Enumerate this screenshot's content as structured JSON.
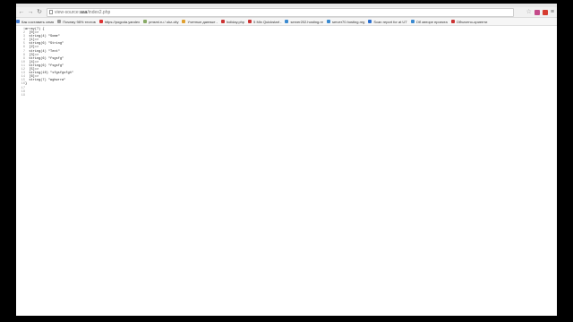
{
  "toolbar": {
    "back_icon": "back-arrow-icon",
    "forward_icon": "forward-arrow-icon",
    "reload_icon": "reload-icon",
    "url_scheme": "view-source:",
    "url_host": "aaa",
    "url_path": "/index2.php"
  },
  "bookmarks": [
    {
      "label": "Как составить семя",
      "color": "#4a7fd0"
    },
    {
      "label": "Почему 98% тестов",
      "color": "#9a9a9a"
    },
    {
      "label": "https://pogoda.yandex",
      "color": "#d33"
    },
    {
      "label": "pmsmi.ru / ukz-city",
      "color": "#8a6"
    },
    {
      "label": "Учетные данные - ",
      "color": "#e0a030"
    },
    {
      "label": "holiday.php",
      "color": "#c33"
    },
    {
      "label": "5 Min Quickstart - ",
      "color": "#c33"
    },
    {
      "label": "server202.hosting.re",
      "color": "#3a8ad0"
    },
    {
      "label": "server70.hosting.reg",
      "color": "#3a8ad0"
    },
    {
      "label": "Scan report for at UT",
      "color": "#2a6fd0"
    },
    {
      "label": "Об авторе проекта",
      "color": "#3a8ad0"
    },
    {
      "label": "Объектно-ориенти",
      "color": "#c33"
    }
  ],
  "source": {
    "line_numbers": [
      "1",
      "2",
      "3",
      "4",
      "5",
      "6",
      "7",
      "8",
      "9",
      "10",
      "11",
      "12",
      "13",
      "14",
      "15",
      "16",
      "17",
      "18",
      "19"
    ],
    "lines": [
      "array(7) {",
      "  [0]=>",
      "  string(4) \"Some\"",
      "  [1]=>",
      "  string(6) \"String\"",
      "  [2]=>",
      "  string(4) \"Text\"",
      "  [3]=>",
      "  string(6) \"fsgsfg\"",
      "  [4]=>",
      "  string(6) \"fsgsfg\"",
      "  [5]=>",
      "  string(10) \"sfgsfgsfgh\"",
      "  [6]=>",
      "  string(7) \"wghwrrw\"",
      "}",
      "",
      "",
      ""
    ]
  }
}
